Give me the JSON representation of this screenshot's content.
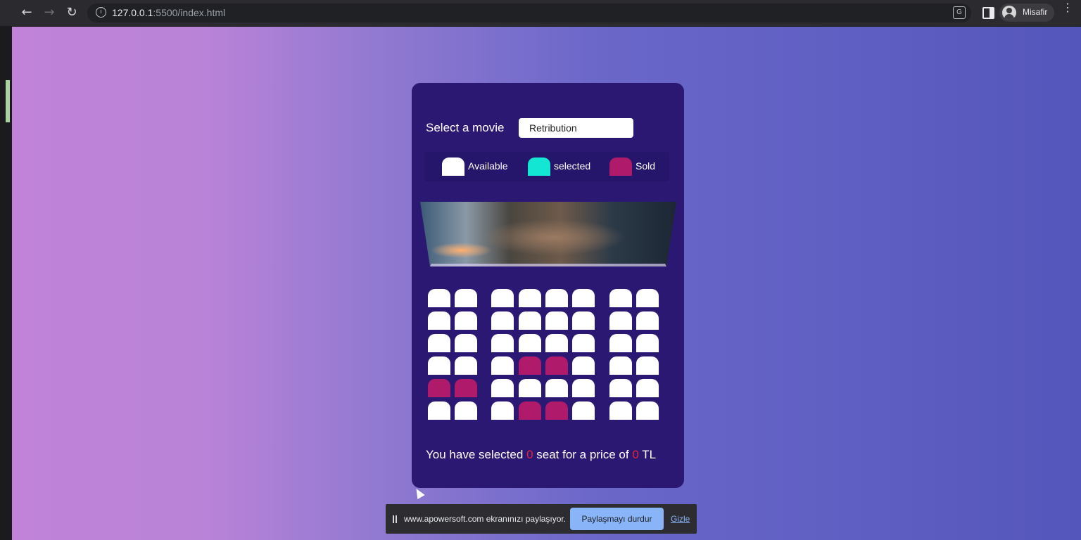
{
  "browser": {
    "url_host": "127.0.0.1",
    "url_rest": ":5500/index.html",
    "profile_name": "Misafir",
    "nav_icons": [
      "arrow-back-icon",
      "arrow-forward-icon",
      "reload-icon"
    ]
  },
  "app": {
    "movie_label": "Select a movie",
    "selected_movie": "Retribution",
    "legend": [
      {
        "label": "Available",
        "color": "#ffffff"
      },
      {
        "label": "selected",
        "color": "#13e6d2"
      },
      {
        "label": "Sold",
        "color": "#b01a6b"
      }
    ],
    "seat_rows": [
      [
        "available",
        "available",
        "available",
        "available",
        "available",
        "available",
        "available",
        "available"
      ],
      [
        "available",
        "available",
        "available",
        "available",
        "available",
        "available",
        "available",
        "available"
      ],
      [
        "available",
        "available",
        "available",
        "available",
        "available",
        "available",
        "available",
        "available"
      ],
      [
        "available",
        "available",
        "available",
        "sold",
        "sold",
        "available",
        "available",
        "available"
      ],
      [
        "sold",
        "sold",
        "available",
        "available",
        "available",
        "available",
        "available",
        "available"
      ],
      [
        "available",
        "available",
        "available",
        "sold",
        "sold",
        "available",
        "available",
        "available"
      ]
    ],
    "summary": {
      "prefix": "You have selected",
      "seat_count": "0",
      "middle": "seat for a price of",
      "price": "0",
      "currency": "TL"
    }
  },
  "share_bar": {
    "text": "www.apowersoft.com ekranınızı paylaşıyor.",
    "stop_label": "Paylaşmayı durdur",
    "hide_label": "Gizle"
  },
  "colors": {
    "card": "#2b1873",
    "available": "#ffffff",
    "selected": "#13e6d2",
    "sold": "#b01a6b",
    "highlight_number": "#e8233b"
  }
}
